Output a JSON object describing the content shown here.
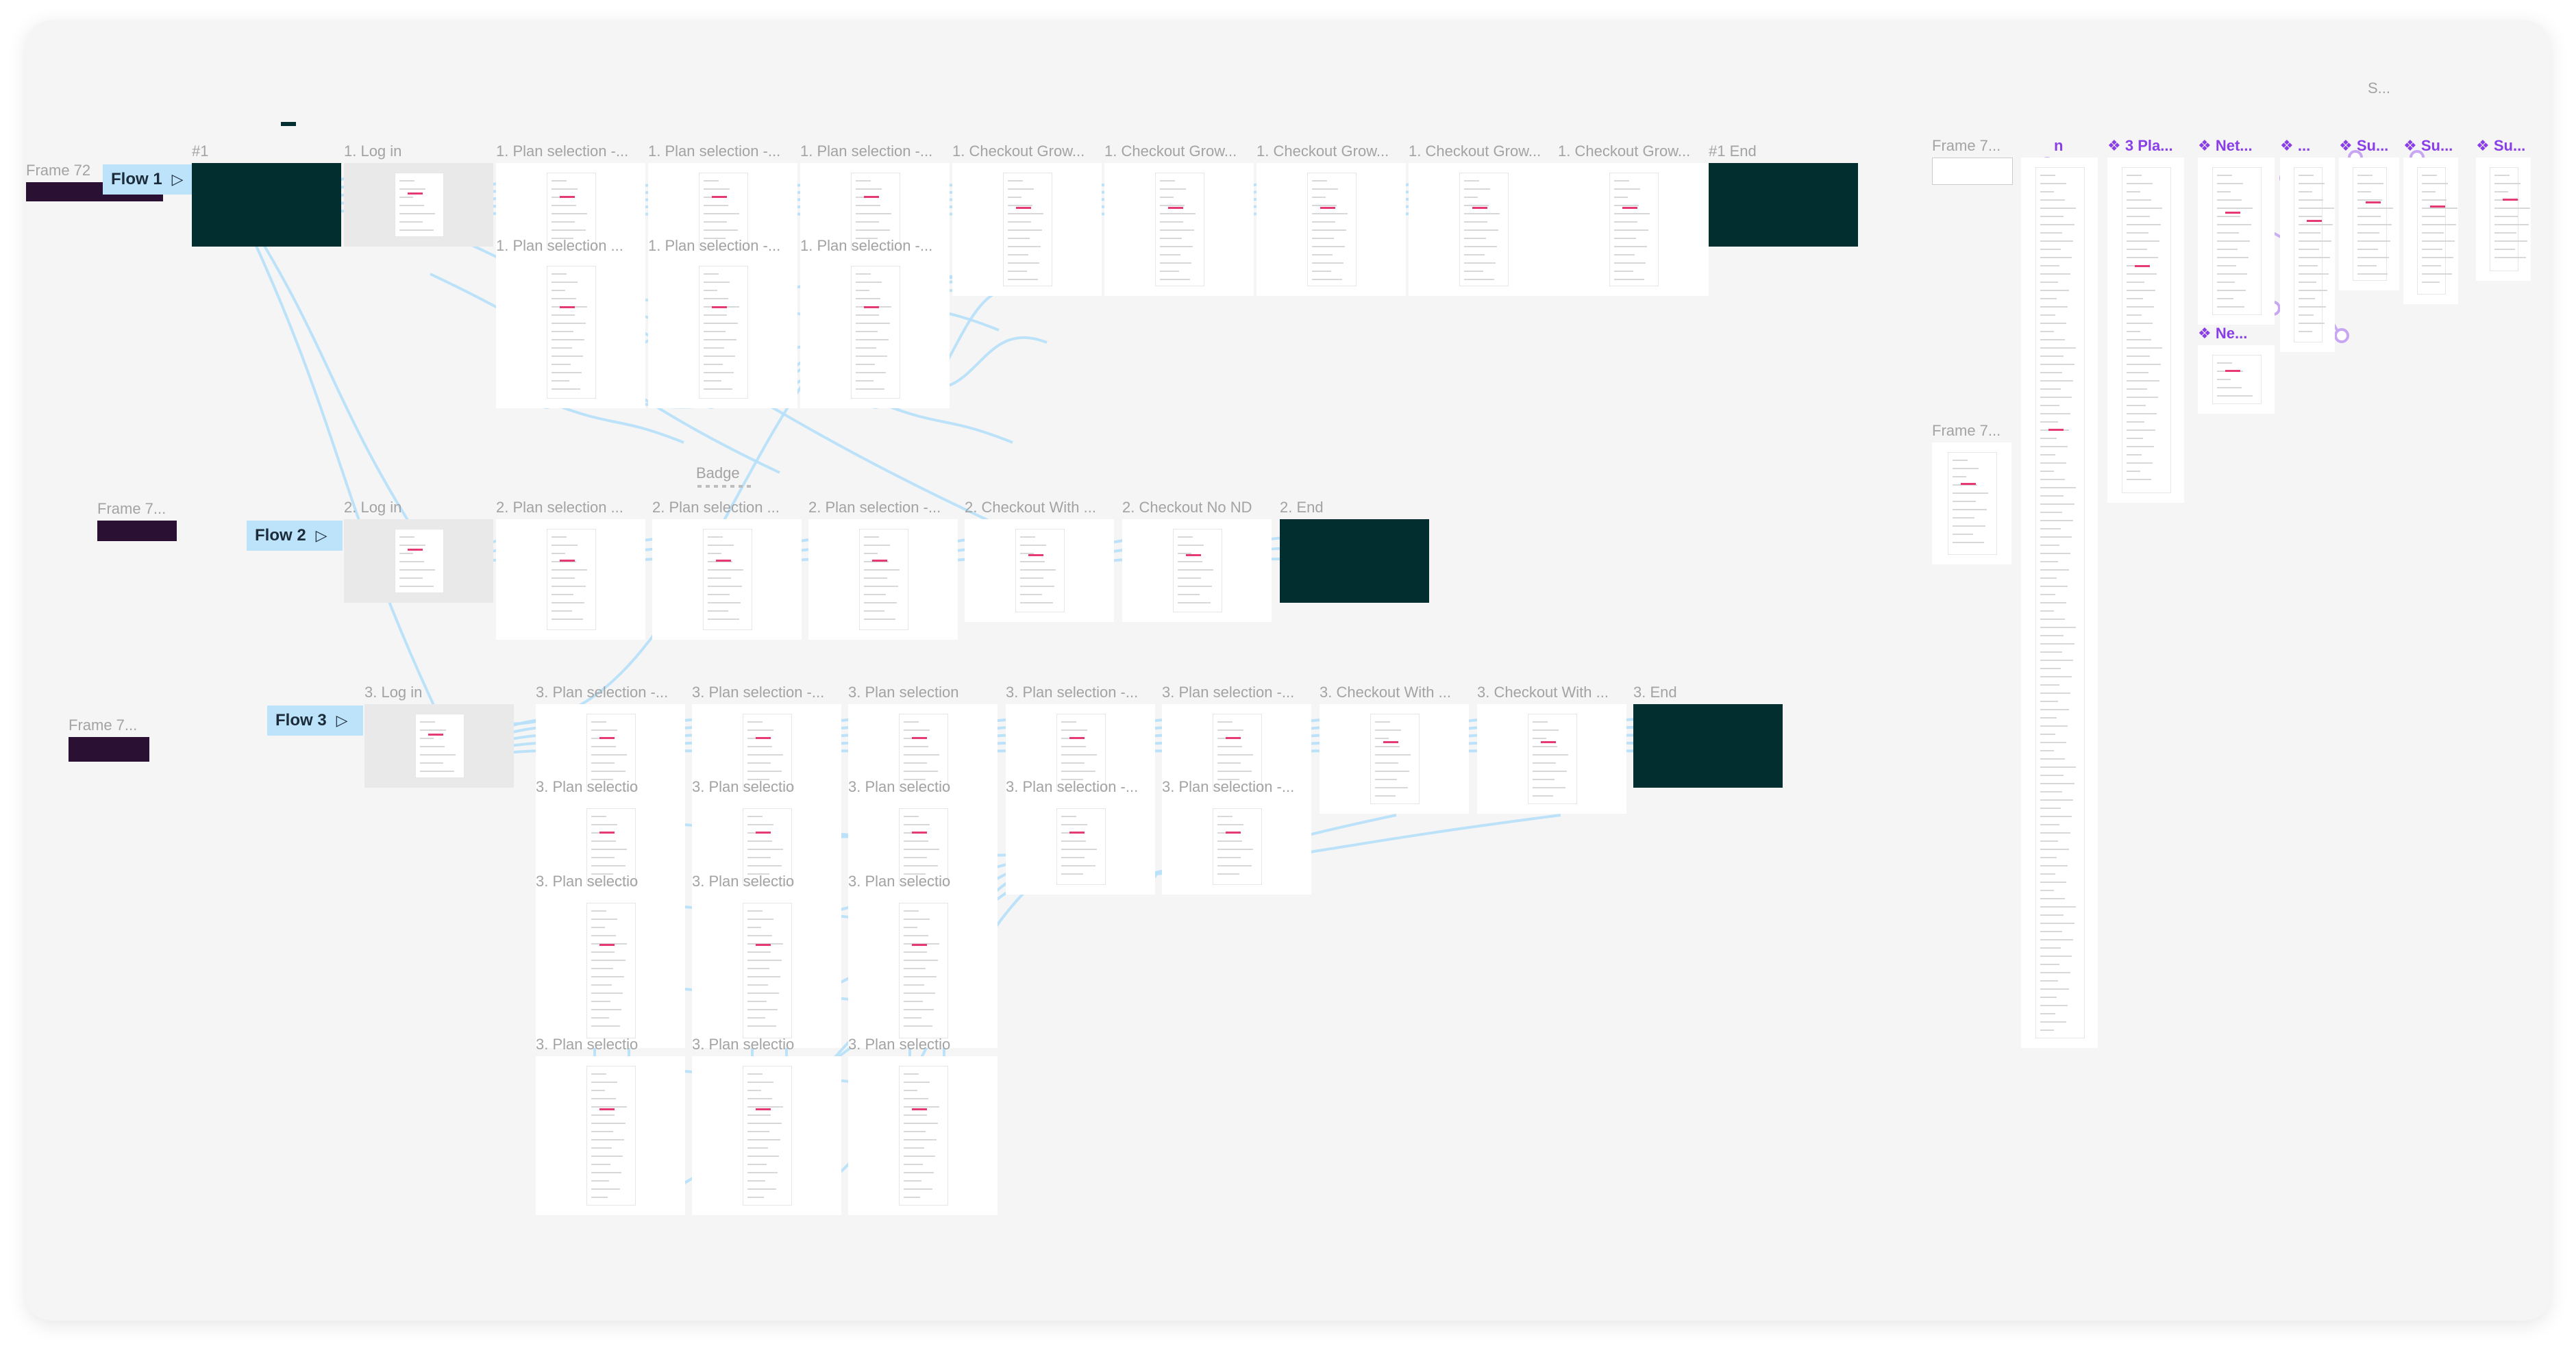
{
  "canvas": {
    "background": "#f5f5f5",
    "wire_color": "#b6e0fa",
    "proto_color": "#c8a6f3",
    "accent_color": "#8a3ee8"
  },
  "flows": [
    {
      "label": "Flow 1",
      "icon": "play-icon"
    },
    {
      "label": "Flow 2",
      "icon": "play-icon"
    },
    {
      "label": "Flow 3",
      "icon": "play-icon"
    }
  ],
  "left_frames": [
    "Frame 72",
    "Frame 7...",
    "Frame 7..."
  ],
  "flow1": {
    "start": "#1",
    "login": "1. Log in",
    "plans_row1": [
      "1. Plan selection -...",
      "1. Plan selection -...",
      "1. Plan selection -..."
    ],
    "plans_row2": [
      "1. Plan selection ...",
      "1. Plan selection -...",
      "1. Plan selection -..."
    ],
    "checkouts": [
      "1. Checkout Grow...",
      "1. Checkout Grow...",
      "1. Checkout Grow...",
      "1. Checkout Grow...",
      "1. Checkout Grow..."
    ],
    "end": "#1 End"
  },
  "badge": "Badge",
  "flow2": {
    "login": "2. Log in",
    "plans": [
      "2. Plan selection ...",
      "2. Plan selection ...",
      "2. Plan selection -..."
    ],
    "checkouts": [
      "2. Checkout With ...",
      "2. Checkout No ND"
    ],
    "end": "2. End"
  },
  "flow3": {
    "login": "3. Log in",
    "plans_row1": [
      "3. Plan selection -...",
      "3. Plan selection -...",
      "3. Plan selection",
      "3. Plan selection -...",
      "3. Plan selection -..."
    ],
    "checkouts": [
      "3. Checkout With ...",
      "3. Checkout With ..."
    ],
    "end": "3. End",
    "plans_row2": [
      "3. Plan selectio",
      "3. Plan selectio",
      "3. Plan selectio",
      "3. Plan selection -...",
      "3. Plan selection -..."
    ],
    "plans_row3": [
      "3. Plan selectio",
      "3. Plan selectio",
      "3. Plan selectio"
    ],
    "plans_row4": [
      "3. Plan selectio",
      "3. Plan selectio",
      "3. Plan selectio"
    ]
  },
  "right": {
    "top_label": "S...",
    "frame_a": "Frame 7...",
    "frame_b": "Frame 7...",
    "components": [
      "n",
      "3 Pla...",
      "Net...",
      "...",
      "Su...",
      "Su...",
      "Su..."
    ],
    "component_b": "Ne..."
  }
}
